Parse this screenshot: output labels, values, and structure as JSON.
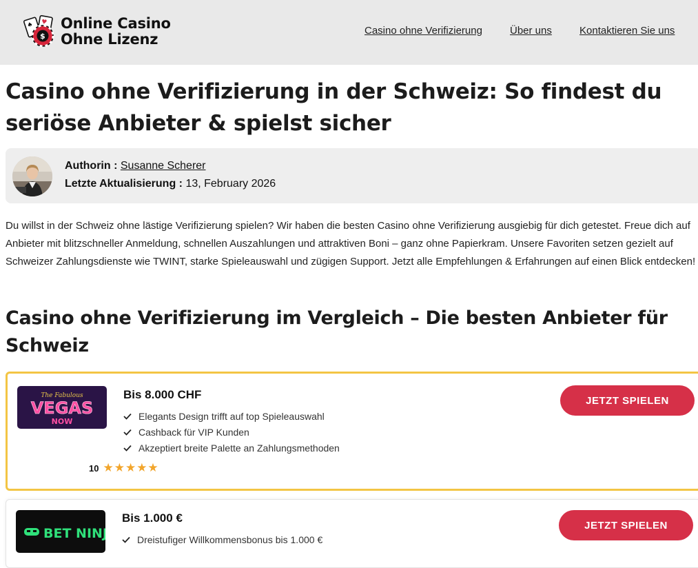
{
  "header": {
    "logo_line1": "Online Casino",
    "logo_line2": "Ohne Lizenz",
    "nav": [
      "Casino ohne Verifizierung",
      "Über uns",
      "Kontaktieren Sie uns"
    ]
  },
  "article": {
    "title": "Casino ohne Verifizierung in der Schweiz: So findest du seriöse Anbieter & spielst sicher",
    "author_label": "Authorin :",
    "author_name": "Susanne Scherer",
    "updated_label": "Letzte Aktualisierung :",
    "updated_date": "13, February 2026",
    "intro": "Du willst in der Schweiz ohne lästige Verifizierung spielen? Wir haben die besten Casino ohne Verifizierung ausgiebig für dich getestet. Freue dich auf Anbieter mit blitzschneller Anmeldung, schnellen Auszahlungen und attraktiven Boni – ganz ohne Papierkram. Unsere Favoriten setzen gezielt auf Schweizer Zahlungsdienste wie TWINT, starke Spieleauswahl und zügigen Support. Jetzt alle Empfehlungen & Erfahrungen auf einen Blick entdecken!",
    "comparison_title": "Casino ohne Verifizierung im Vergleich – Die besten Anbieter für Schweiz"
  },
  "casinos": [
    {
      "logo_small": "The Fabulous",
      "logo_main": "VEGAS",
      "logo_sub": "NOW",
      "bonus": "Bis 8.000 CHF",
      "features": [
        "Elegants Design trifft auf top Spieleauswahl",
        "Cashback für VIP Kunden",
        "Akzeptiert breite Palette an Zahlungsmethoden"
      ],
      "rating": "10",
      "stars": "★★★★★",
      "cta": "JETZT SPIELEN"
    },
    {
      "logo_main": "BET NINJA",
      "bonus": "Bis 1.000 €",
      "features": [
        "Dreistufiger Willkommensbonus bis 1.000 €"
      ],
      "cta": "JETZT SPIELEN"
    }
  ],
  "colors": {
    "header_bg": "#e9e9e9",
    "cta": "#d63048",
    "featured_border": "#f3c544",
    "stars": "#f2a52b"
  },
  "icons": [
    "playing-cards-chip-logo",
    "check-icon",
    "star-icon"
  ]
}
